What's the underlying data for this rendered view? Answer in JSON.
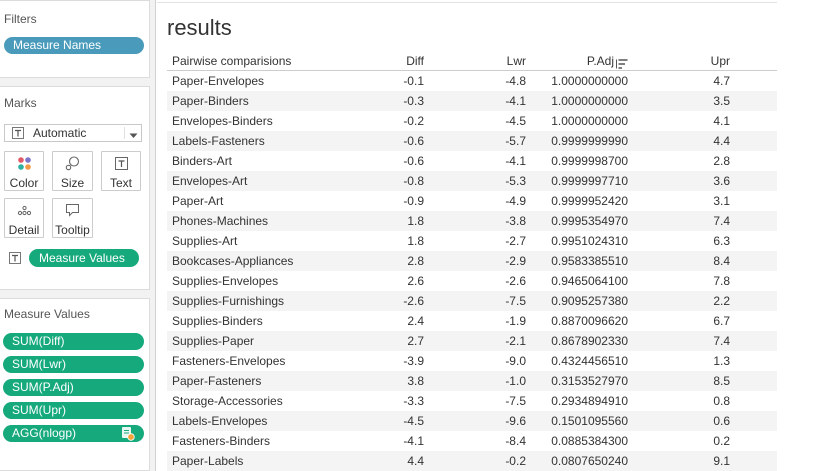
{
  "sidebar": {
    "filters": {
      "title": "Filters",
      "pills": [
        "Measure Names"
      ]
    },
    "marks": {
      "title": "Marks",
      "mark_type": {
        "label": "Automatic",
        "icon": "text-mark-icon"
      },
      "buttons": [
        {
          "label": "Color",
          "icon": "color-icon"
        },
        {
          "label": "Size",
          "icon": "size-icon"
        },
        {
          "label": "Text",
          "icon": "text-icon"
        },
        {
          "label": "Detail",
          "icon": "detail-icon"
        },
        {
          "label": "Tooltip",
          "icon": "tooltip-icon"
        }
      ],
      "text_field": {
        "icon": "text-encoding-icon",
        "pill": "Measure Values"
      }
    },
    "measure_values": {
      "title": "Measure Values",
      "pills": [
        {
          "label": "SUM(Diff)"
        },
        {
          "label": "SUM(Lwr)"
        },
        {
          "label": "SUM(P.Adj)"
        },
        {
          "label": "SUM(Upr)"
        },
        {
          "label": "AGG(nlogp)",
          "icon": "calculated-field-icon"
        }
      ]
    }
  },
  "worksheet": {
    "title": "results",
    "columns": [
      {
        "label": "Pairwise comparisions"
      },
      {
        "label": "Diff"
      },
      {
        "label": "Lwr"
      },
      {
        "label": "P.Adj",
        "sort_icon": "sort-descending-icon"
      },
      {
        "label": "Upr"
      }
    ],
    "rows": [
      {
        "pair": "Paper-Envelopes",
        "diff": "-0.1",
        "lwr": "-4.8",
        "p_adj": "1.0000000000",
        "upr": "4.7"
      },
      {
        "pair": "Paper-Binders",
        "diff": "-0.3",
        "lwr": "-4.1",
        "p_adj": "1.0000000000",
        "upr": "3.5"
      },
      {
        "pair": "Envelopes-Binders",
        "diff": "-0.2",
        "lwr": "-4.5",
        "p_adj": "1.0000000000",
        "upr": "4.1"
      },
      {
        "pair": "Labels-Fasteners",
        "diff": "-0.6",
        "lwr": "-5.7",
        "p_adj": "0.9999999990",
        "upr": "4.4"
      },
      {
        "pair": "Binders-Art",
        "diff": "-0.6",
        "lwr": "-4.1",
        "p_adj": "0.9999998700",
        "upr": "2.8"
      },
      {
        "pair": "Envelopes-Art",
        "diff": "-0.8",
        "lwr": "-5.3",
        "p_adj": "0.9999997710",
        "upr": "3.6"
      },
      {
        "pair": "Paper-Art",
        "diff": "-0.9",
        "lwr": "-4.9",
        "p_adj": "0.9999952420",
        "upr": "3.1"
      },
      {
        "pair": "Phones-Machines",
        "diff": "1.8",
        "lwr": "-3.8",
        "p_adj": "0.9995354970",
        "upr": "7.4"
      },
      {
        "pair": "Supplies-Art",
        "diff": "1.8",
        "lwr": "-2.7",
        "p_adj": "0.9951024310",
        "upr": "6.3"
      },
      {
        "pair": "Bookcases-Appliances",
        "diff": "2.8",
        "lwr": "-2.9",
        "p_adj": "0.9583385510",
        "upr": "8.4"
      },
      {
        "pair": "Supplies-Envelopes",
        "diff": "2.6",
        "lwr": "-2.6",
        "p_adj": "0.9465064100",
        "upr": "7.8"
      },
      {
        "pair": "Supplies-Furnishings",
        "diff": "-2.6",
        "lwr": "-7.5",
        "p_adj": "0.9095257380",
        "upr": "2.2"
      },
      {
        "pair": "Supplies-Binders",
        "diff": "2.4",
        "lwr": "-1.9",
        "p_adj": "0.8870096620",
        "upr": "6.7"
      },
      {
        "pair": "Supplies-Paper",
        "diff": "2.7",
        "lwr": "-2.1",
        "p_adj": "0.8678902330",
        "upr": "7.4"
      },
      {
        "pair": "Fasteners-Envelopes",
        "diff": "-3.9",
        "lwr": "-9.0",
        "p_adj": "0.4324456510",
        "upr": "1.3"
      },
      {
        "pair": "Paper-Fasteners",
        "diff": "3.8",
        "lwr": "-1.0",
        "p_adj": "0.3153527970",
        "upr": "8.5"
      },
      {
        "pair": "Storage-Accessories",
        "diff": "-3.3",
        "lwr": "-7.5",
        "p_adj": "0.2934894910",
        "upr": "0.8"
      },
      {
        "pair": "Labels-Envelopes",
        "diff": "-4.5",
        "lwr": "-9.6",
        "p_adj": "0.1501095560",
        "upr": "0.6"
      },
      {
        "pair": "Fasteners-Binders",
        "diff": "-4.1",
        "lwr": "-8.4",
        "p_adj": "0.0885384300",
        "upr": "0.2"
      },
      {
        "pair": "Paper-Labels",
        "diff": "4.4",
        "lwr": "-0.2",
        "p_adj": "0.0807650240",
        "upr": "9.1"
      }
    ]
  },
  "colors": {
    "discrete_pill": "#4a9bbb",
    "continuous_pill": "#16a97b",
    "row_band": "#f4f4f4"
  }
}
